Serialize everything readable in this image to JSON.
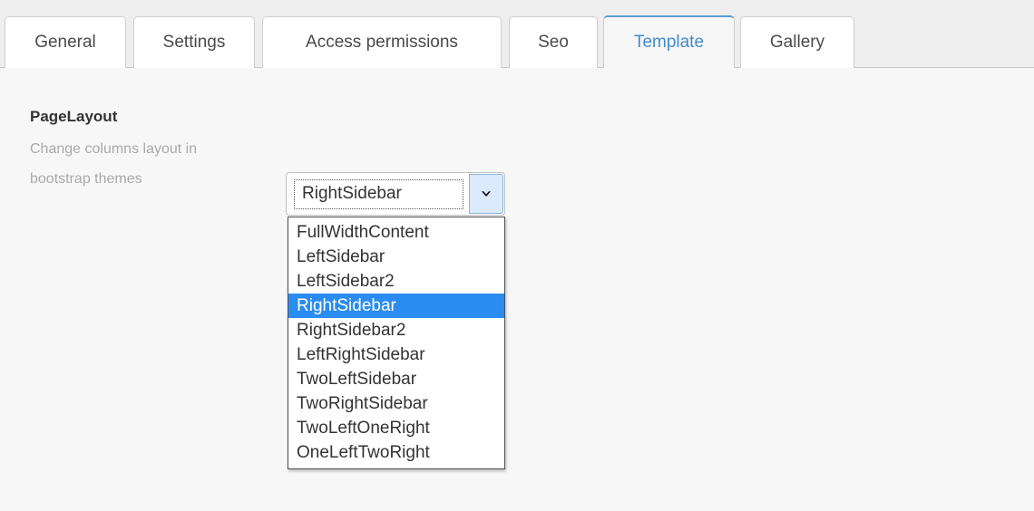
{
  "tabs": [
    {
      "label": "General",
      "active": false
    },
    {
      "label": "Settings",
      "active": false
    },
    {
      "label": "Access permissions",
      "active": false
    },
    {
      "label": "Seo",
      "active": false
    },
    {
      "label": "Template",
      "active": true
    },
    {
      "label": "Gallery",
      "active": false
    }
  ],
  "field": {
    "title": "PageLayout",
    "help_line1": "Change columns layout in",
    "help_line2": "bootstrap themes"
  },
  "select": {
    "value": "RightSidebar",
    "arrow_icon": "chevron-down-icon",
    "expanded": true,
    "options": [
      "FullWidthContent",
      "LeftSidebar",
      "LeftSidebar2",
      "RightSidebar",
      "RightSidebar2",
      "LeftRightSidebar",
      "TwoLeftSidebar",
      "TwoRightSidebar",
      "TwoLeftOneRight",
      "OneLeftTwoRight"
    ],
    "selected_option": "RightSidebar"
  },
  "colors": {
    "active_tab_text": "#428bca",
    "active_tab_border": "#5b9bd5",
    "option_highlight": "#2a8cf0",
    "tabstrip_bg": "#eeeeee",
    "content_bg": "#f7f7f7",
    "help_text": "#aaaaaa"
  }
}
